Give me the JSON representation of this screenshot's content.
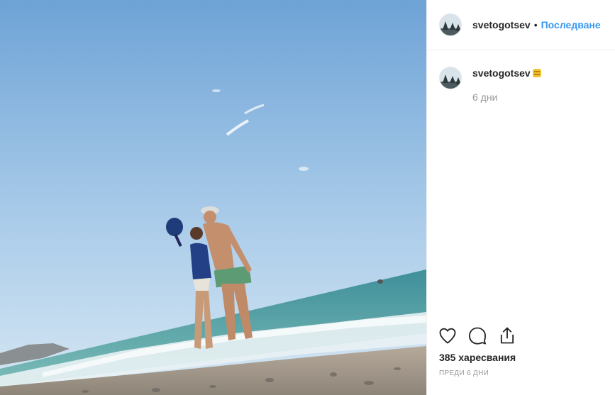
{
  "header": {
    "username": "svetogotsev",
    "separator": "•",
    "follow_label": "Последване"
  },
  "caption": {
    "username": "svetogotsev",
    "emoji": "flag-emoji",
    "time": "6 дни"
  },
  "actions": {
    "like_icon": "heart-icon",
    "comment_icon": "comment-bubble-icon",
    "share_icon": "share-icon"
  },
  "likes": "385 харесвания",
  "posted": "ПРЕДИ 6 ДНИ",
  "colors": {
    "follow_blue": "#3897f0",
    "text": "#262626",
    "muted": "#999999",
    "border": "#efefef"
  }
}
